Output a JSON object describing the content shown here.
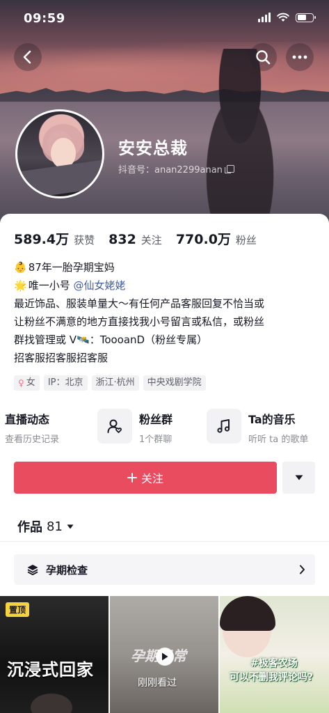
{
  "status_bar": {
    "time": "09:59"
  },
  "profile": {
    "nickname": "安安总裁",
    "douyin_id": "抖音号：anan2299anan"
  },
  "stats": [
    {
      "value": "589.4万",
      "label": "获赞"
    },
    {
      "value": "832",
      "label": "关注"
    },
    {
      "value": "770.0万",
      "label": "粉丝"
    }
  ],
  "bio": {
    "line1_emoji": "👶",
    "line1_text": "87年一胎孕期宝妈",
    "line2_emoji": "🌟",
    "line2_text": "唯一小号 ",
    "line2_mention": "@仙女姥姥",
    "line3": "最近饰品、服装单量大～有任何产品客服回复不恰当或",
    "line4": "让粉丝不满意的地方直接找我小号留言或私信，或粉丝",
    "line5": "群找管理或 V🛰️：TooоanD（粉丝专属）",
    "line6": "招客服招客服招客服"
  },
  "tags": [
    {
      "icon": "female-icon",
      "label": "女"
    },
    {
      "label": "IP：北京"
    },
    {
      "label": "浙江·杭州"
    },
    {
      "label": "中央戏剧学院"
    }
  ],
  "features": [
    {
      "title": "直播动态",
      "subtitle": "查看历史记录"
    },
    {
      "title": "粉丝群",
      "subtitle": "1个群聊",
      "icon": "fan-group-icon"
    },
    {
      "title": "Ta的音乐",
      "subtitle": "听听 ta 的歌单",
      "icon": "music-note-icon"
    }
  ],
  "follow_button": {
    "label": "关注",
    "color": "#ea4c5f"
  },
  "works_tab": {
    "label": "作品",
    "count": "81"
  },
  "collection": {
    "label": "孕期检查"
  },
  "videos": [
    {
      "badge": "置顶",
      "title": "沉浸式回家"
    },
    {
      "title": "孕期日常",
      "overlay": "刚刚看过"
    },
    {
      "title_line1": "#极客农场",
      "title_line2": "可以不删我评论吗?"
    }
  ]
}
